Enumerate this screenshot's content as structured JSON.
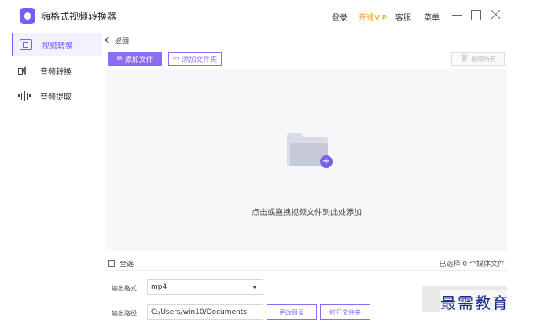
{
  "app": {
    "title": "嗨格式视频转换器"
  },
  "titlebar": {
    "login": "登录",
    "vip": "开通VIP",
    "service": "客服",
    "menu": "菜单"
  },
  "sidebar": {
    "items": [
      {
        "label": "视频转换",
        "icon": "video-convert-icon",
        "active": true
      },
      {
        "label": "音频转换",
        "icon": "audio-convert-icon",
        "active": false
      },
      {
        "label": "音频提取",
        "icon": "audio-extract-icon",
        "active": false
      }
    ]
  },
  "main": {
    "back_label": "返回",
    "add_file_label": "添加文件",
    "add_folder_label": "添加文件夹",
    "delete_all_label": "删除所有",
    "drop_hint": "点击或拖拽视频文件到此处添加",
    "select_all_label": "全选",
    "selected_count": "已选择 0 个媒体文件"
  },
  "output": {
    "format_label": "输出格式:",
    "format_value": "mp4",
    "path_label": "输出路径:",
    "path_value": "C:/Users/win10/Documents",
    "change_dir_label": "更改目录",
    "open_folder_label": "打开文件夹"
  },
  "watermark": {
    "text": "最需教育"
  },
  "colors": {
    "accent": "#7b5cf0",
    "vip": "#f2a500"
  }
}
